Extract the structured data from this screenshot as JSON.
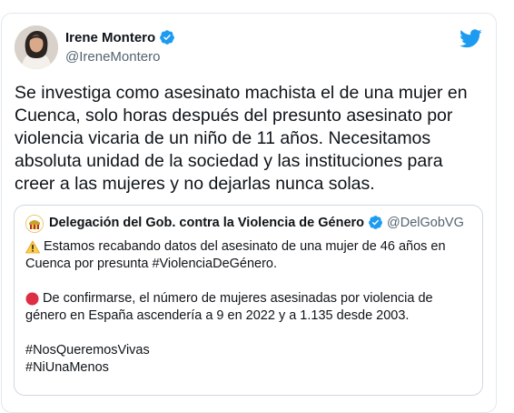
{
  "author": {
    "name": "Irene Montero",
    "handle": "@IreneMontero"
  },
  "tweet": {
    "text": "Se investiga como asesinato machista el de una mujer en\nCuenca, solo horas después del presunto asesinato por\nviolencia vicaria de un niño de 11 años. Necesitamos\nabsoluta unidad de la sociedad y las instituciones para\ncreer a las mujeres y no dejarlas nunca solas."
  },
  "quoted": {
    "name": "Delegación del Gob. contra la Violencia de Género",
    "handle": "@DelGobVG",
    "lines": [
      "Estamos recabando datos del asesinato de una mujer de 46 años en",
      "Cuenca por presunta #ViolenciaDeGénero.",
      "De confirmarse, el número de mujeres asesinadas por violencia de",
      "género en España ascendería a 9 en 2022 y a 1.135 desde 2003.",
      "#NosQueremosVivas",
      "#NiUnaMenos"
    ]
  },
  "icons": {
    "brand": "twitter-bird-icon",
    "verified": "verified-badge-icon",
    "warning": "warning-emoji-icon",
    "red_circle": "red-circle-emoji-icon"
  },
  "colors": {
    "twitter_blue": "#1d9bf0",
    "text": "#0f1419",
    "secondary": "#536471",
    "border": "#cfd9de",
    "red": "#dd2e44",
    "warning": "#ffcc4d"
  }
}
